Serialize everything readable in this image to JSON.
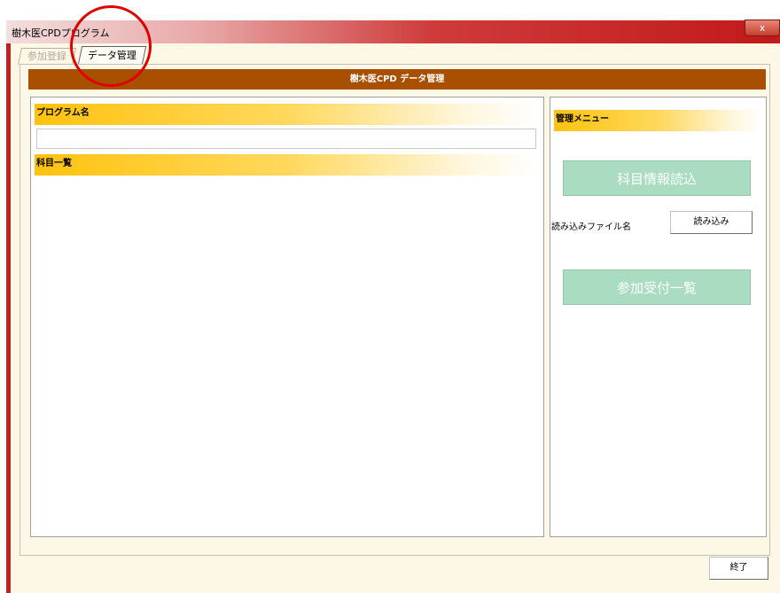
{
  "window": {
    "title": "樹木医CPDプログラム",
    "close_label": "x"
  },
  "tabs": [
    {
      "label": "参加登録",
      "active": false
    },
    {
      "label": "データ管理",
      "active": true
    }
  ],
  "header": {
    "title": "樹木医CPD データ管理"
  },
  "left": {
    "program_label": "プログラム名",
    "program_value": "",
    "subjects_label": "科目一覧"
  },
  "right": {
    "menu_label": "管理メニュー",
    "load_subject_button": "科目情報読込",
    "file_label": "読み込みファイル名",
    "read_button": "読み込み",
    "reception_button": "参加受付一覧"
  },
  "footer": {
    "exit_button": "終了"
  },
  "colors": {
    "title_bar": "#c2191a",
    "header_bar": "#a94f00",
    "section_head": "#ffc20e",
    "disabled_button": "#a9dcc0",
    "annotation_circle": "#e00000"
  }
}
